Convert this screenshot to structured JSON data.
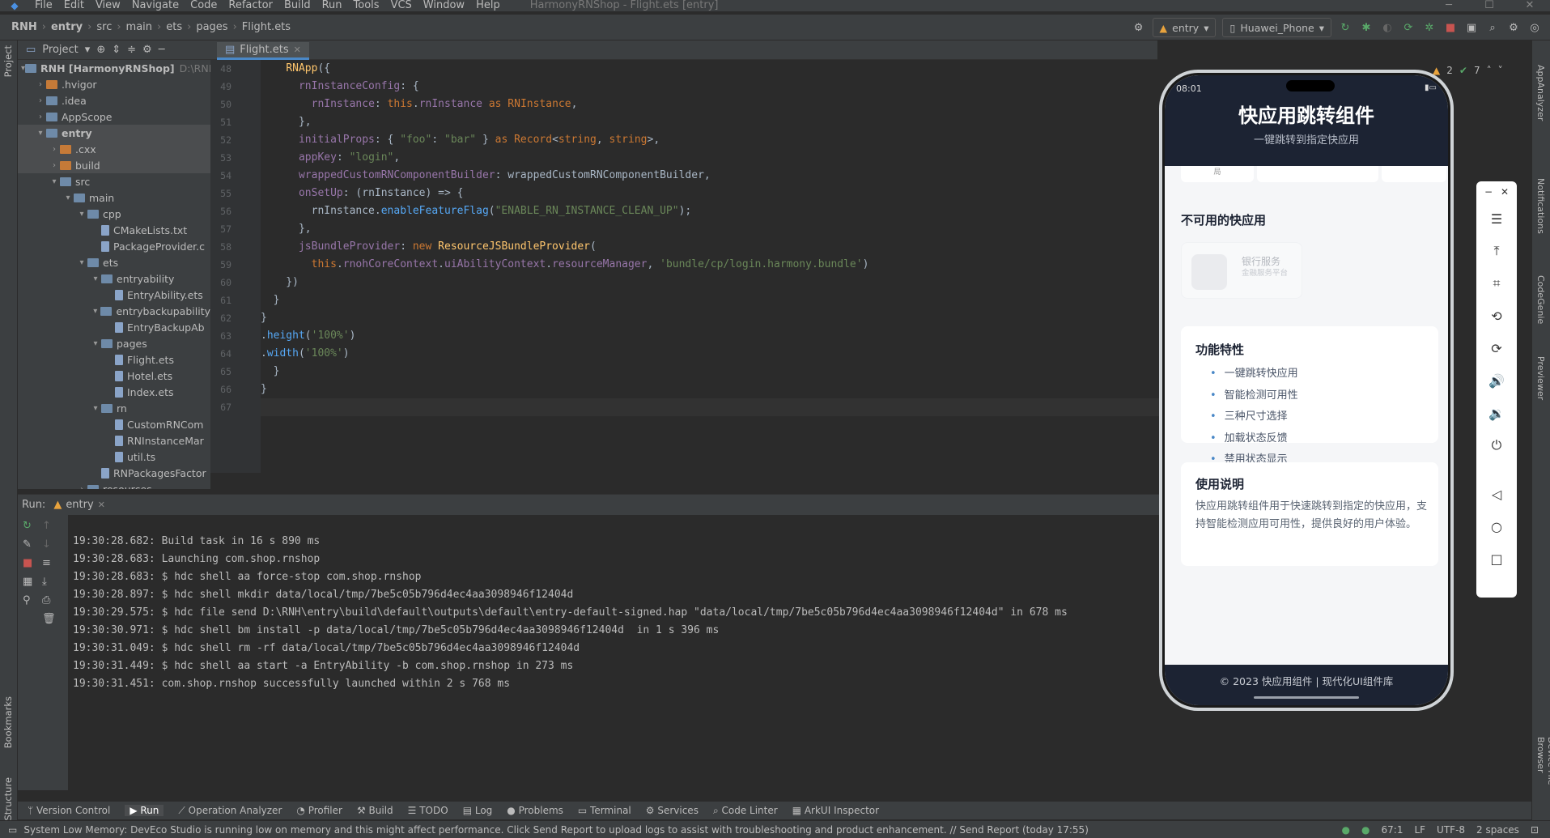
{
  "menu": {
    "items": [
      "File",
      "Edit",
      "View",
      "Navigate",
      "Code",
      "Refactor",
      "Build",
      "Run",
      "Tools",
      "VCS",
      "Window",
      "Help"
    ],
    "window_title": "HarmonyRNShop - Flight.ets [entry]"
  },
  "nav": {
    "crumbs": [
      "RNH",
      "entry",
      "src",
      "main",
      "ets",
      "pages",
      "Flight.ets"
    ],
    "run_config": "entry",
    "device": "Huawei_Phone"
  },
  "project": {
    "header": "Project",
    "tree": [
      {
        "label": "RNH [HarmonyRNShop]",
        "extra": "D:\\RNH",
        "indent": 0,
        "arrow": "▾",
        "icon": "fold",
        "bold": true
      },
      {
        "label": ".hvigor",
        "indent": 1,
        "arrow": "›",
        "icon": "foldo"
      },
      {
        "label": ".idea",
        "indent": 1,
        "arrow": "›",
        "icon": "fold"
      },
      {
        "label": "AppScope",
        "indent": 1,
        "arrow": "›",
        "icon": "fold"
      },
      {
        "label": "entry",
        "indent": 1,
        "arrow": "▾",
        "icon": "fold",
        "bold": true,
        "sel": true
      },
      {
        "label": ".cxx",
        "indent": 2,
        "arrow": "›",
        "icon": "foldo",
        "sel": true
      },
      {
        "label": "build",
        "indent": 2,
        "arrow": "›",
        "icon": "foldo",
        "sel": true
      },
      {
        "label": "src",
        "indent": 2,
        "arrow": "▾",
        "icon": "fold"
      },
      {
        "label": "main",
        "indent": 3,
        "arrow": "▾",
        "icon": "fold"
      },
      {
        "label": "cpp",
        "indent": 4,
        "arrow": "▾",
        "icon": "fold"
      },
      {
        "label": "CMakeLists.txt",
        "indent": 5,
        "arrow": "",
        "icon": "file"
      },
      {
        "label": "PackageProvider.c",
        "indent": 5,
        "arrow": "",
        "icon": "file"
      },
      {
        "label": "ets",
        "indent": 4,
        "arrow": "▾",
        "icon": "fold"
      },
      {
        "label": "entryability",
        "indent": 5,
        "arrow": "▾",
        "icon": "fold"
      },
      {
        "label": "EntryAbility.ets",
        "indent": 6,
        "arrow": "",
        "icon": "file"
      },
      {
        "label": "entrybackupability",
        "indent": 5,
        "arrow": "▾",
        "icon": "fold"
      },
      {
        "label": "EntryBackupAb",
        "indent": 6,
        "arrow": "",
        "icon": "file"
      },
      {
        "label": "pages",
        "indent": 5,
        "arrow": "▾",
        "icon": "fold"
      },
      {
        "label": "Flight.ets",
        "indent": 6,
        "arrow": "",
        "icon": "file"
      },
      {
        "label": "Hotel.ets",
        "indent": 6,
        "arrow": "",
        "icon": "file"
      },
      {
        "label": "Index.ets",
        "indent": 6,
        "arrow": "",
        "icon": "file"
      },
      {
        "label": "rn",
        "indent": 5,
        "arrow": "▾",
        "icon": "fold"
      },
      {
        "label": "CustomRNCom",
        "indent": 6,
        "arrow": "",
        "icon": "file"
      },
      {
        "label": "RNInstanceMar",
        "indent": 6,
        "arrow": "",
        "icon": "file"
      },
      {
        "label": "util.ts",
        "indent": 6,
        "arrow": "",
        "icon": "file"
      },
      {
        "label": "RNPackagesFactor",
        "indent": 5,
        "arrow": "",
        "icon": "file"
      },
      {
        "label": "resources",
        "indent": 4,
        "arrow": "›",
        "icon": "fold"
      }
    ]
  },
  "editor": {
    "tab": "Flight.ets",
    "line_numbers": [
      "48",
      "49",
      "50",
      "51",
      "52",
      "53",
      "54",
      "55",
      "56",
      "57",
      "58",
      "59",
      "60",
      "61",
      "62",
      "63",
      "64",
      "65",
      "66",
      "67"
    ]
  },
  "run": {
    "label": "Run:",
    "tab": "entry",
    "lines": [
      "19:30:28.682: Build task in 16 s 890 ms",
      "19:30:28.683: Launching com.shop.rnshop",
      "19:30:28.683: $ hdc shell aa force-stop com.shop.rnshop",
      "19:30:28.897: $ hdc shell mkdir data/local/tmp/7be5c05b796d4ec4aa3098946f12404d",
      "19:30:29.575: $ hdc file send D:\\RNH\\entry\\build\\default\\outputs\\default\\entry-default-signed.hap \"data/local/tmp/7be5c05b796d4ec4aa3098946f12404d\" in 678 ms",
      "19:30:30.971: $ hdc shell bm install -p data/local/tmp/7be5c05b796d4ec4aa3098946f12404d  in 1 s 396 ms",
      "19:30:31.049: $ hdc shell rm -rf data/local/tmp/7be5c05b796d4ec4aa3098946f12404d",
      "19:30:31.449: $ hdc shell aa start -a EntryAbility -b com.shop.rnshop in 273 ms",
      "19:30:31.451: com.shop.rnshop successfully launched within 2 s 768 ms"
    ]
  },
  "bottom_tools": [
    "Version Control",
    "Run",
    "Operation Analyzer",
    "Profiler",
    "Build",
    "TODO",
    "Log",
    "Problems",
    "Terminal",
    "Services",
    "Code Linter",
    "ArkUI Inspector"
  ],
  "status": {
    "message": "System Low Memory: DevEco Studio is running low on memory and this might affect performance. Click Send Report to upload logs to assist with troubleshooting and product enhancement. // Send Report (today 17:55)",
    "position": "67:1",
    "line_sep": "LF",
    "encoding": "UTF-8",
    "indent": "2 spaces"
  },
  "side_tools": {
    "left": [
      "Project",
      "Bookmarks",
      "Structure"
    ],
    "right": [
      "AppAnalyzer",
      "Notifications",
      "CodeGenie",
      "Previewer",
      "Device File Browser"
    ]
  },
  "inspections": {
    "warnings": "2",
    "ok": "7"
  },
  "phone": {
    "time": "08:01",
    "title": "快应用跳转组件",
    "subtitle": "一键跳转到指定快应用",
    "partial_label": "局",
    "unavailable_title": "不可用的快应用",
    "disabled_app_name": "银行服务",
    "disabled_app_desc": "金融服务平台",
    "features_title": "功能特性",
    "features": [
      "一键跳转快应用",
      "智能检测可用性",
      "三种尺寸选择",
      "加载状态反馈",
      "禁用状态显示"
    ],
    "usage_title": "使用说明",
    "usage_text": "快应用跳转组件用于快速跳转到指定的快应用，支持智能检测应用可用性，提供良好的用户体验。",
    "footer": "© 2023 快应用组件 | 现代化UI组件库"
  },
  "colors": {
    "accent": "#4a88c7",
    "phone_header": "#1c2333",
    "bullet": "#4a88c7"
  }
}
